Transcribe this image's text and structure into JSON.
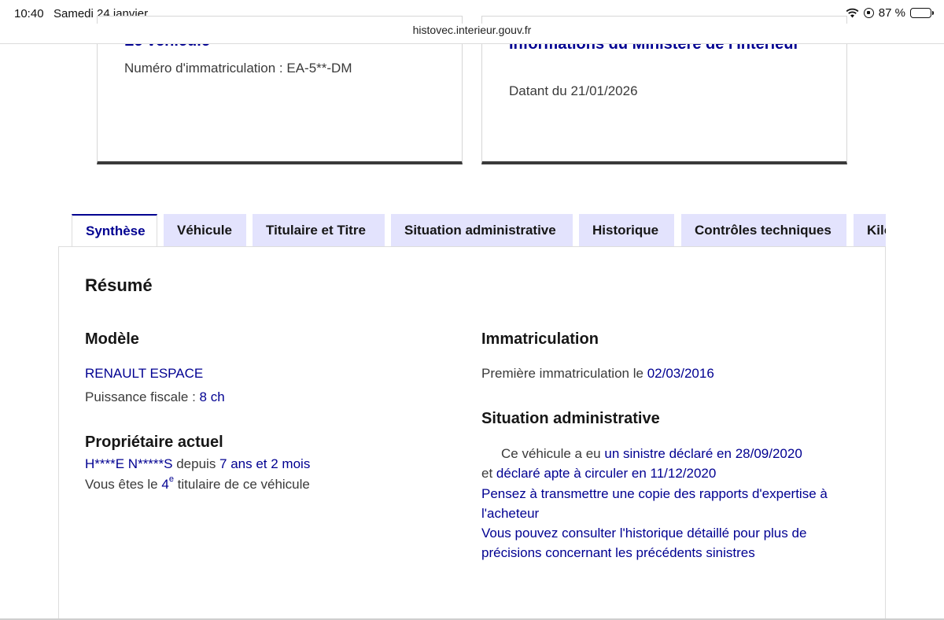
{
  "status": {
    "time": "10:40",
    "date": "Samedi 24 janvier",
    "battery": "87 %",
    "battery_level": 0.87
  },
  "browser": {
    "url": "histovec.interieur.gouv.fr"
  },
  "cards": {
    "left": {
      "title": "Le véhicule",
      "subtitle": "Numéro d'immatriculation : EA-5**-DM"
    },
    "right": {
      "title": "Informations du Ministère de l'Intérieur",
      "subtitle": "Datant du 21/01/2026"
    }
  },
  "tabs": [
    {
      "label": "Synthèse",
      "active": true
    },
    {
      "label": "Véhicule"
    },
    {
      "label": "Titulaire et Titre"
    },
    {
      "label": "Situation administrative"
    },
    {
      "label": "Historique"
    },
    {
      "label": "Contrôles techniques"
    },
    {
      "label": "Kilométrage"
    }
  ],
  "resume": {
    "heading": "Résumé",
    "modele": {
      "heading": "Modèle",
      "name": "RENAULT ESPACE",
      "puissance_label": "Puissance fiscale : ",
      "puissance_value": "8 ch"
    },
    "proprietaire": {
      "heading": "Propriétaire actuel",
      "name": "H****E N*****S",
      "depuis_label": " depuis ",
      "depuis_value": "7 ans et 2 mois",
      "rank_prefix": "Vous êtes le ",
      "rank_num": "4",
      "rank_sup": "e",
      "rank_suffix": " titulaire de ce véhicule"
    },
    "immatriculation": {
      "heading": "Immatriculation",
      "label": "Première immatriculation le ",
      "date": "02/03/2016"
    },
    "situation": {
      "heading": "Situation administrative",
      "line1_prefix": "Ce véhicule a eu ",
      "line1_link": "un sinistre déclaré en 28/09/2020",
      "line2_prefix": "et ",
      "line2_link": "déclaré apte à circuler en 11/12/2020",
      "line3": "Pensez à transmettre une copie des rapports d'expertise à",
      "line4": "l'acheteur",
      "line5": "Vous pouvez consulter l'historique détaillé pour plus de",
      "line6": "précisions concernant les précédents sinistres"
    }
  }
}
